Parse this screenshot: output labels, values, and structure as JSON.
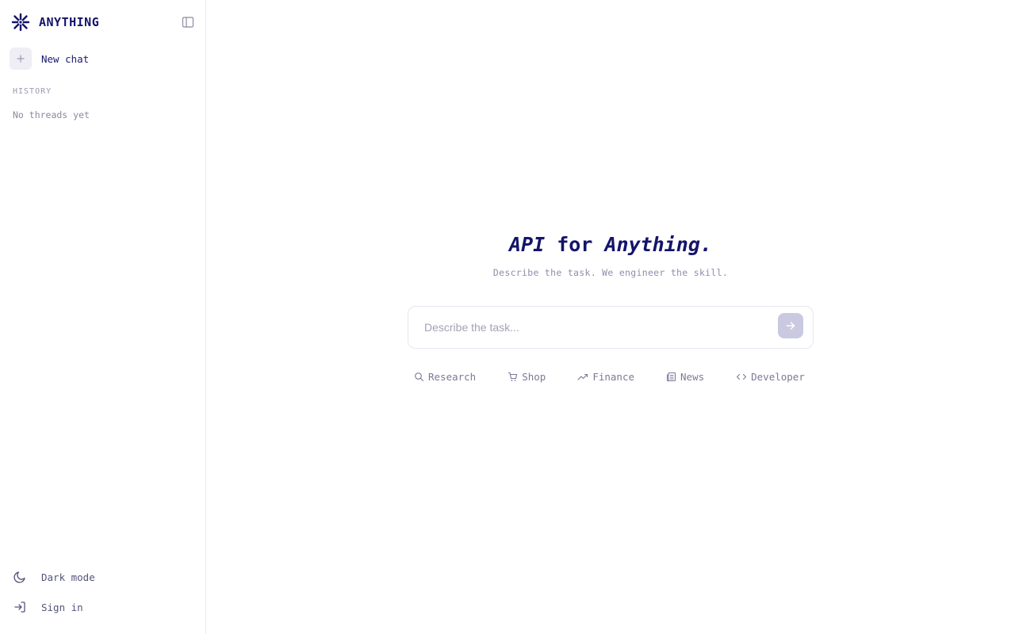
{
  "brand": {
    "name": "ANYTHING",
    "color": "#14146b"
  },
  "sidebar": {
    "new_chat_label": "New chat",
    "history_heading": "HISTORY",
    "history_empty": "No threads yet",
    "bottom": {
      "dark_mode_label": "Dark mode",
      "sign_in_label": "Sign in"
    }
  },
  "hero": {
    "title_part1": "API",
    "title_part2": " for ",
    "title_part3": "Anything",
    "title_part4": ".",
    "subtitle": "Describe the task. We engineer the skill."
  },
  "prompt": {
    "placeholder": "Describe the task...",
    "value": ""
  },
  "chips": [
    {
      "label": "Research",
      "icon": "search-icon"
    },
    {
      "label": "Shop",
      "icon": "cart-icon"
    },
    {
      "label": "Finance",
      "icon": "trending-up-icon"
    },
    {
      "label": "News",
      "icon": "newspaper-icon"
    },
    {
      "label": "Developer",
      "icon": "code-icon"
    }
  ],
  "colors": {
    "accent": "#14146b",
    "muted": "#8e8eaa",
    "send_button": "#c9c9e0",
    "border": "#e6e6ef"
  }
}
